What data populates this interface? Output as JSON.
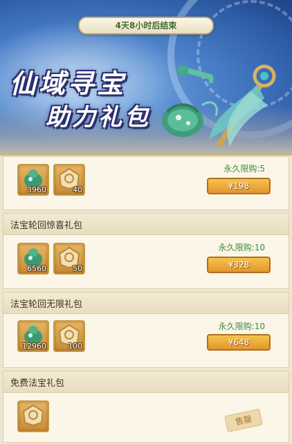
{
  "banner": {
    "timer": "4天8小时后结束",
    "title_line1": "仙域寻宝",
    "title_line2": "助力礼包"
  },
  "packs": [
    {
      "title": "",
      "items": [
        {
          "icon": "jade-gourd-icon",
          "count": "3960"
        },
        {
          "icon": "golden-token-icon",
          "count": "40"
        }
      ],
      "limit": "永久限购:5",
      "price": "¥198"
    },
    {
      "title": "法宝轮回惊喜礼包",
      "items": [
        {
          "icon": "jade-gourd-icon",
          "count": "6560"
        },
        {
          "icon": "golden-token-icon",
          "count": "50"
        }
      ],
      "limit": "永久限购:10",
      "price": "¥328"
    },
    {
      "title": "法宝轮回无限礼包",
      "items": [
        {
          "icon": "jade-gourd-icon",
          "count": "12960"
        },
        {
          "icon": "golden-token-icon",
          "count": "100"
        }
      ],
      "limit": "永久限购:10",
      "price": "¥648"
    },
    {
      "title": "免费法宝礼包",
      "items": [
        {
          "icon": "golden-token-icon",
          "count": ""
        }
      ],
      "status": "售罄"
    }
  ],
  "colors": {
    "accent_price": "#e2962c",
    "limit_text": "#3d8a3a",
    "banner_blue": "#4a7fc8"
  }
}
